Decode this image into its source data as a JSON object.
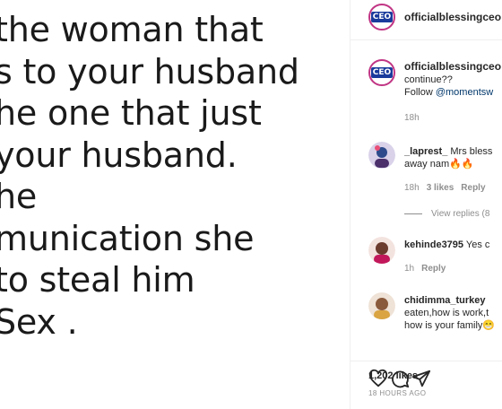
{
  "post": {
    "lines": [
      "the woman that",
      "s to your husband",
      "he one that just",
      "your husband.",
      "he",
      "munication she",
      " to steal him",
      "Sex ."
    ]
  },
  "header": {
    "username": "officialblessingceo"
  },
  "caption": {
    "username": "officialblessingceo",
    "line1": "continue??",
    "follow_prefix": "Follow ",
    "mention": "@momentsw",
    "time": "18h"
  },
  "comments": [
    {
      "username": "_laprest_",
      "text1": "Mrs bless",
      "text2": "away nam🔥🔥",
      "time": "18h",
      "likes": "3 likes",
      "reply": "Reply"
    },
    {
      "username": "kehinde3795",
      "text1": "Yes c",
      "time": "1h",
      "reply": "Reply"
    },
    {
      "username": "chidimma_turkey",
      "text1": "eaten,how is work,t",
      "text2": "how is your family😁"
    }
  ],
  "view_replies": "View replies (8",
  "likes": "1,202 likes",
  "time_ago": "18 HOURS AGO",
  "icons": {
    "brand_badge": "CEO",
    "like": "heart-icon",
    "comment": "comment-icon",
    "share": "share-icon"
  },
  "colors": {
    "link": "#00376b",
    "muted": "#8e8e8e",
    "brand_ring": "#c13584",
    "brand_badge": "#1a3b9c"
  }
}
